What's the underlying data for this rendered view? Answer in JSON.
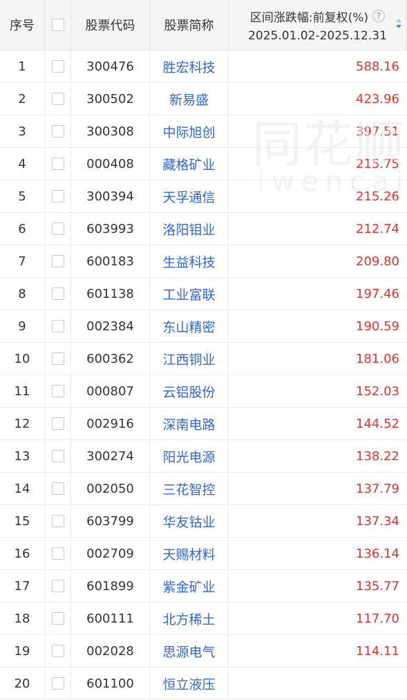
{
  "header": {
    "seq": "序号",
    "code": "股票代码",
    "name": "股票简称",
    "change_title": "区间涨跌幅:前复权(%)",
    "change_range": "2025.01.02-2025.12.31",
    "help": "?"
  },
  "watermark": {
    "line1": "同花顺",
    "line2": "iwencai"
  },
  "colors": {
    "name": "#3366cc",
    "value": "#e03030",
    "sort_active": "#4a90e2"
  },
  "rows": [
    {
      "seq": "1",
      "code": "300476",
      "name": "胜宏科技",
      "change": "588.16"
    },
    {
      "seq": "2",
      "code": "300502",
      "name": "新易盛",
      "change": "423.96"
    },
    {
      "seq": "3",
      "code": "300308",
      "name": "中际旭创",
      "change": "397.51"
    },
    {
      "seq": "4",
      "code": "000408",
      "name": "藏格矿业",
      "change": "215.75"
    },
    {
      "seq": "5",
      "code": "300394",
      "name": "天孚通信",
      "change": "215.26"
    },
    {
      "seq": "6",
      "code": "603993",
      "name": "洛阳钼业",
      "change": "212.74"
    },
    {
      "seq": "7",
      "code": "600183",
      "name": "生益科技",
      "change": "209.80"
    },
    {
      "seq": "8",
      "code": "601138",
      "name": "工业富联",
      "change": "197.46"
    },
    {
      "seq": "9",
      "code": "002384",
      "name": "东山精密",
      "change": "190.59"
    },
    {
      "seq": "10",
      "code": "600362",
      "name": "江西铜业",
      "change": "181.06"
    },
    {
      "seq": "11",
      "code": "000807",
      "name": "云铝股份",
      "change": "152.03"
    },
    {
      "seq": "12",
      "code": "002916",
      "name": "深南电路",
      "change": "144.52"
    },
    {
      "seq": "13",
      "code": "300274",
      "name": "阳光电源",
      "change": "138.22"
    },
    {
      "seq": "14",
      "code": "002050",
      "name": "三花智控",
      "change": "137.79"
    },
    {
      "seq": "15",
      "code": "603799",
      "name": "华友钴业",
      "change": "137.34"
    },
    {
      "seq": "16",
      "code": "002709",
      "name": "天赐材料",
      "change": "136.14"
    },
    {
      "seq": "17",
      "code": "601899",
      "name": "紫金矿业",
      "change": "135.77"
    },
    {
      "seq": "18",
      "code": "600111",
      "name": "北方稀土",
      "change": "117.70"
    },
    {
      "seq": "19",
      "code": "002028",
      "name": "思源电气",
      "change": "114.11"
    },
    {
      "seq": "20",
      "code": "601100",
      "name": "恒立液压",
      "change": ""
    }
  ]
}
